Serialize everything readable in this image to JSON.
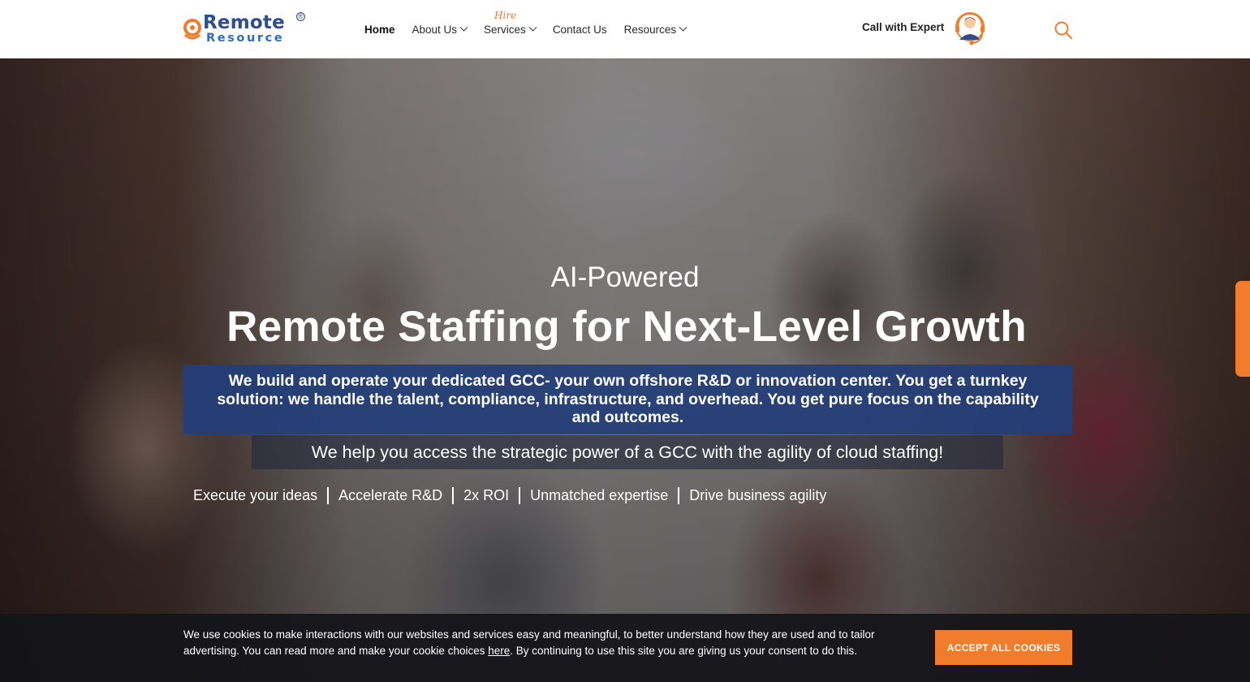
{
  "brand": {
    "logo_top": "Remote",
    "logo_bottom": "Resource",
    "logo_reg": "®",
    "accent": "#f07c2c",
    "navy": "#2f4d8f"
  },
  "nav": {
    "items": [
      {
        "label": "Home",
        "active": true
      },
      {
        "label": "About Us",
        "has_dropdown": true
      },
      {
        "label": "Services",
        "tag": "Hire",
        "has_dropdown": true
      },
      {
        "label": "Contact Us"
      },
      {
        "label": "Resources",
        "has_dropdown": true
      }
    ],
    "call_label": "Call with Expert",
    "call_icon": "headset-agent-icon",
    "search_icon": "search-icon"
  },
  "hero": {
    "eyebrow": "AI-Powered",
    "headline": "Remote Staffing for Next-Level Growth",
    "description": "We build and operate your dedicated GCC- your own offshore R&D or innovation center. You get a turnkey solution: we handle the talent, compliance, infrastructure, and overhead. You get pure focus on the capability and outcomes.",
    "subline": "We help you access the strategic power of a GCC with the agility of cloud staffing!",
    "tags": [
      "Execute your ideas",
      "Accelerate R&D",
      "2x ROI",
      "Unmatched expertise",
      "Drive business agility"
    ]
  },
  "cookie": {
    "text_before": "We use cookies to make interactions with our websites and services easy and meaningful, to better understand how they are used and to tailor advertising. You can read more and make your cookie choices ",
    "link_text": "here",
    "text_after": ". By continuing to use this site you are giving us your consent to do this.",
    "button_label": "ACCEPT ALL COOKIES"
  }
}
